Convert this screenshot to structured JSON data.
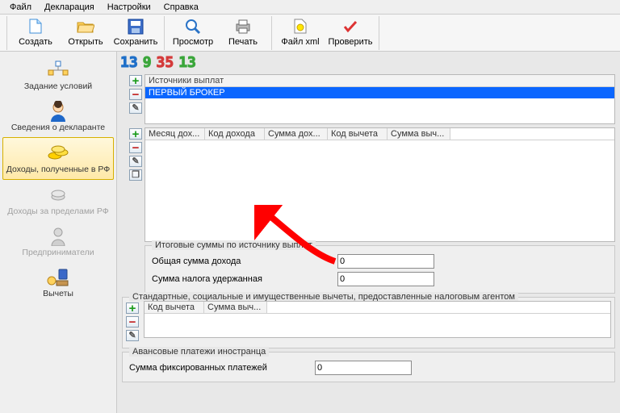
{
  "menu": {
    "file": "Файл",
    "decl": "Декларация",
    "settings": "Настройки",
    "help": "Справка"
  },
  "toolbar": {
    "create": "Создать",
    "open": "Открыть",
    "save": "Сохранить",
    "preview": "Просмотр",
    "print": "Печать",
    "xml": "Файл xml",
    "check": "Проверить"
  },
  "digits": {
    "a": "13",
    "b": "9",
    "c": "35",
    "d": "13"
  },
  "sidebar": {
    "cond": "Задание условий",
    "declarant": "Сведения о декларанте",
    "income_rf": "Доходы, полученные в РФ",
    "income_out": "Доходы за пределами РФ",
    "entrepreneur": "Предприниматели",
    "deductions": "Вычеты"
  },
  "sources": {
    "title": "Источники выплат",
    "row1": "ПЕРВЫЙ БРОКЕР"
  },
  "income_tbl": {
    "c1": "Месяц дох...",
    "c2": "Код дохода",
    "c3": "Сумма дох...",
    "c4": "Код вычета",
    "c5": "Сумма выч..."
  },
  "totals": {
    "legend": "Итоговые суммы по источнику выплат",
    "total_income_lbl": "Общая сумма дохода",
    "total_income_val": "0",
    "tax_withheld_lbl": "Сумма налога удержанная",
    "tax_withheld_val": "0"
  },
  "deductions_panel": {
    "legend": "Стандартные, социальные и имущественные вычеты, предоставленные налоговым агентом",
    "c1": "Код вычета",
    "c2": "Сумма выч..."
  },
  "advance": {
    "legend": "Авансовые платежи иностранца",
    "fixed_lbl": "Сумма фиксированных платежей",
    "fixed_val": "0"
  }
}
